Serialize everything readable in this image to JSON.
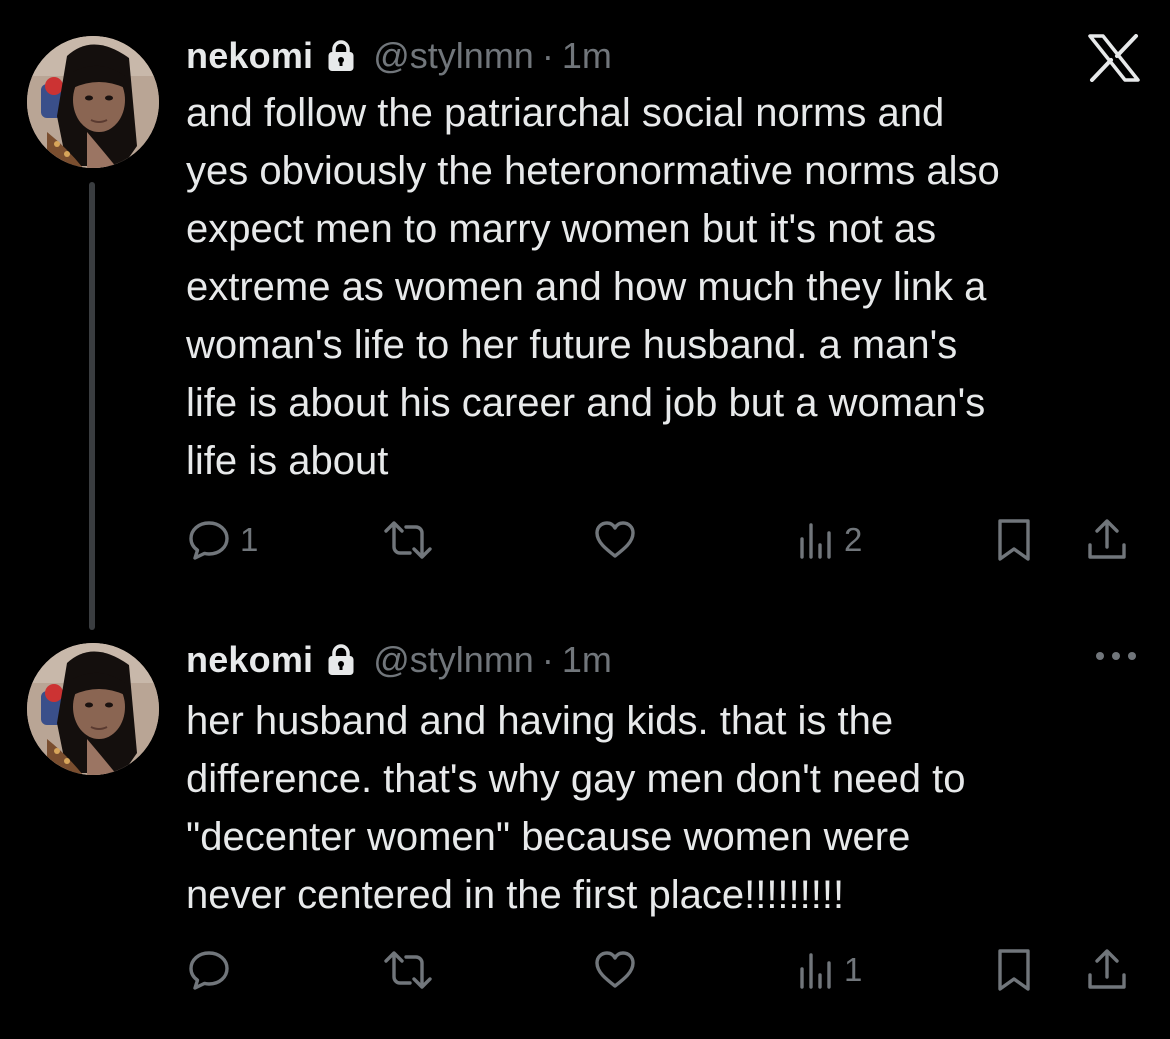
{
  "tweets": [
    {
      "name": "nekomi",
      "handle": "@stylnmn",
      "separator": "·",
      "time": "1m",
      "text": "and follow the patriarchal social norms and\nyes obviously the heteronormative norms also\nexpect men to marry women but it's not as\nextreme as women and how much they link a\nwoman's life to her future husband. a man's\nlife is about his career and job but a woman's\nlife is about",
      "reply_count": "1",
      "retweet_count": "",
      "like_count": "",
      "view_count": "2",
      "corner_icon": "x-logo-icon"
    },
    {
      "name": "nekomi",
      "handle": "@stylnmn",
      "separator": "·",
      "time": "1m",
      "text": "her husband and having kids. that is the\ndifference. that's why gay men don't need to\n\"decenter women\" because women were\nnever centered in the first place!!!!!!!!!",
      "reply_count": "",
      "retweet_count": "",
      "like_count": "",
      "view_count": "1",
      "corner_icon": "more-icon"
    }
  ],
  "colors": {
    "background": "#000000",
    "text_primary": "#e7e9ea",
    "text_secondary": "#71767b",
    "thread_line": "#3a3d40"
  },
  "icons": [
    "lock-icon",
    "reply-icon",
    "retweet-icon",
    "like-icon",
    "views-icon",
    "bookmark-icon",
    "share-icon"
  ]
}
